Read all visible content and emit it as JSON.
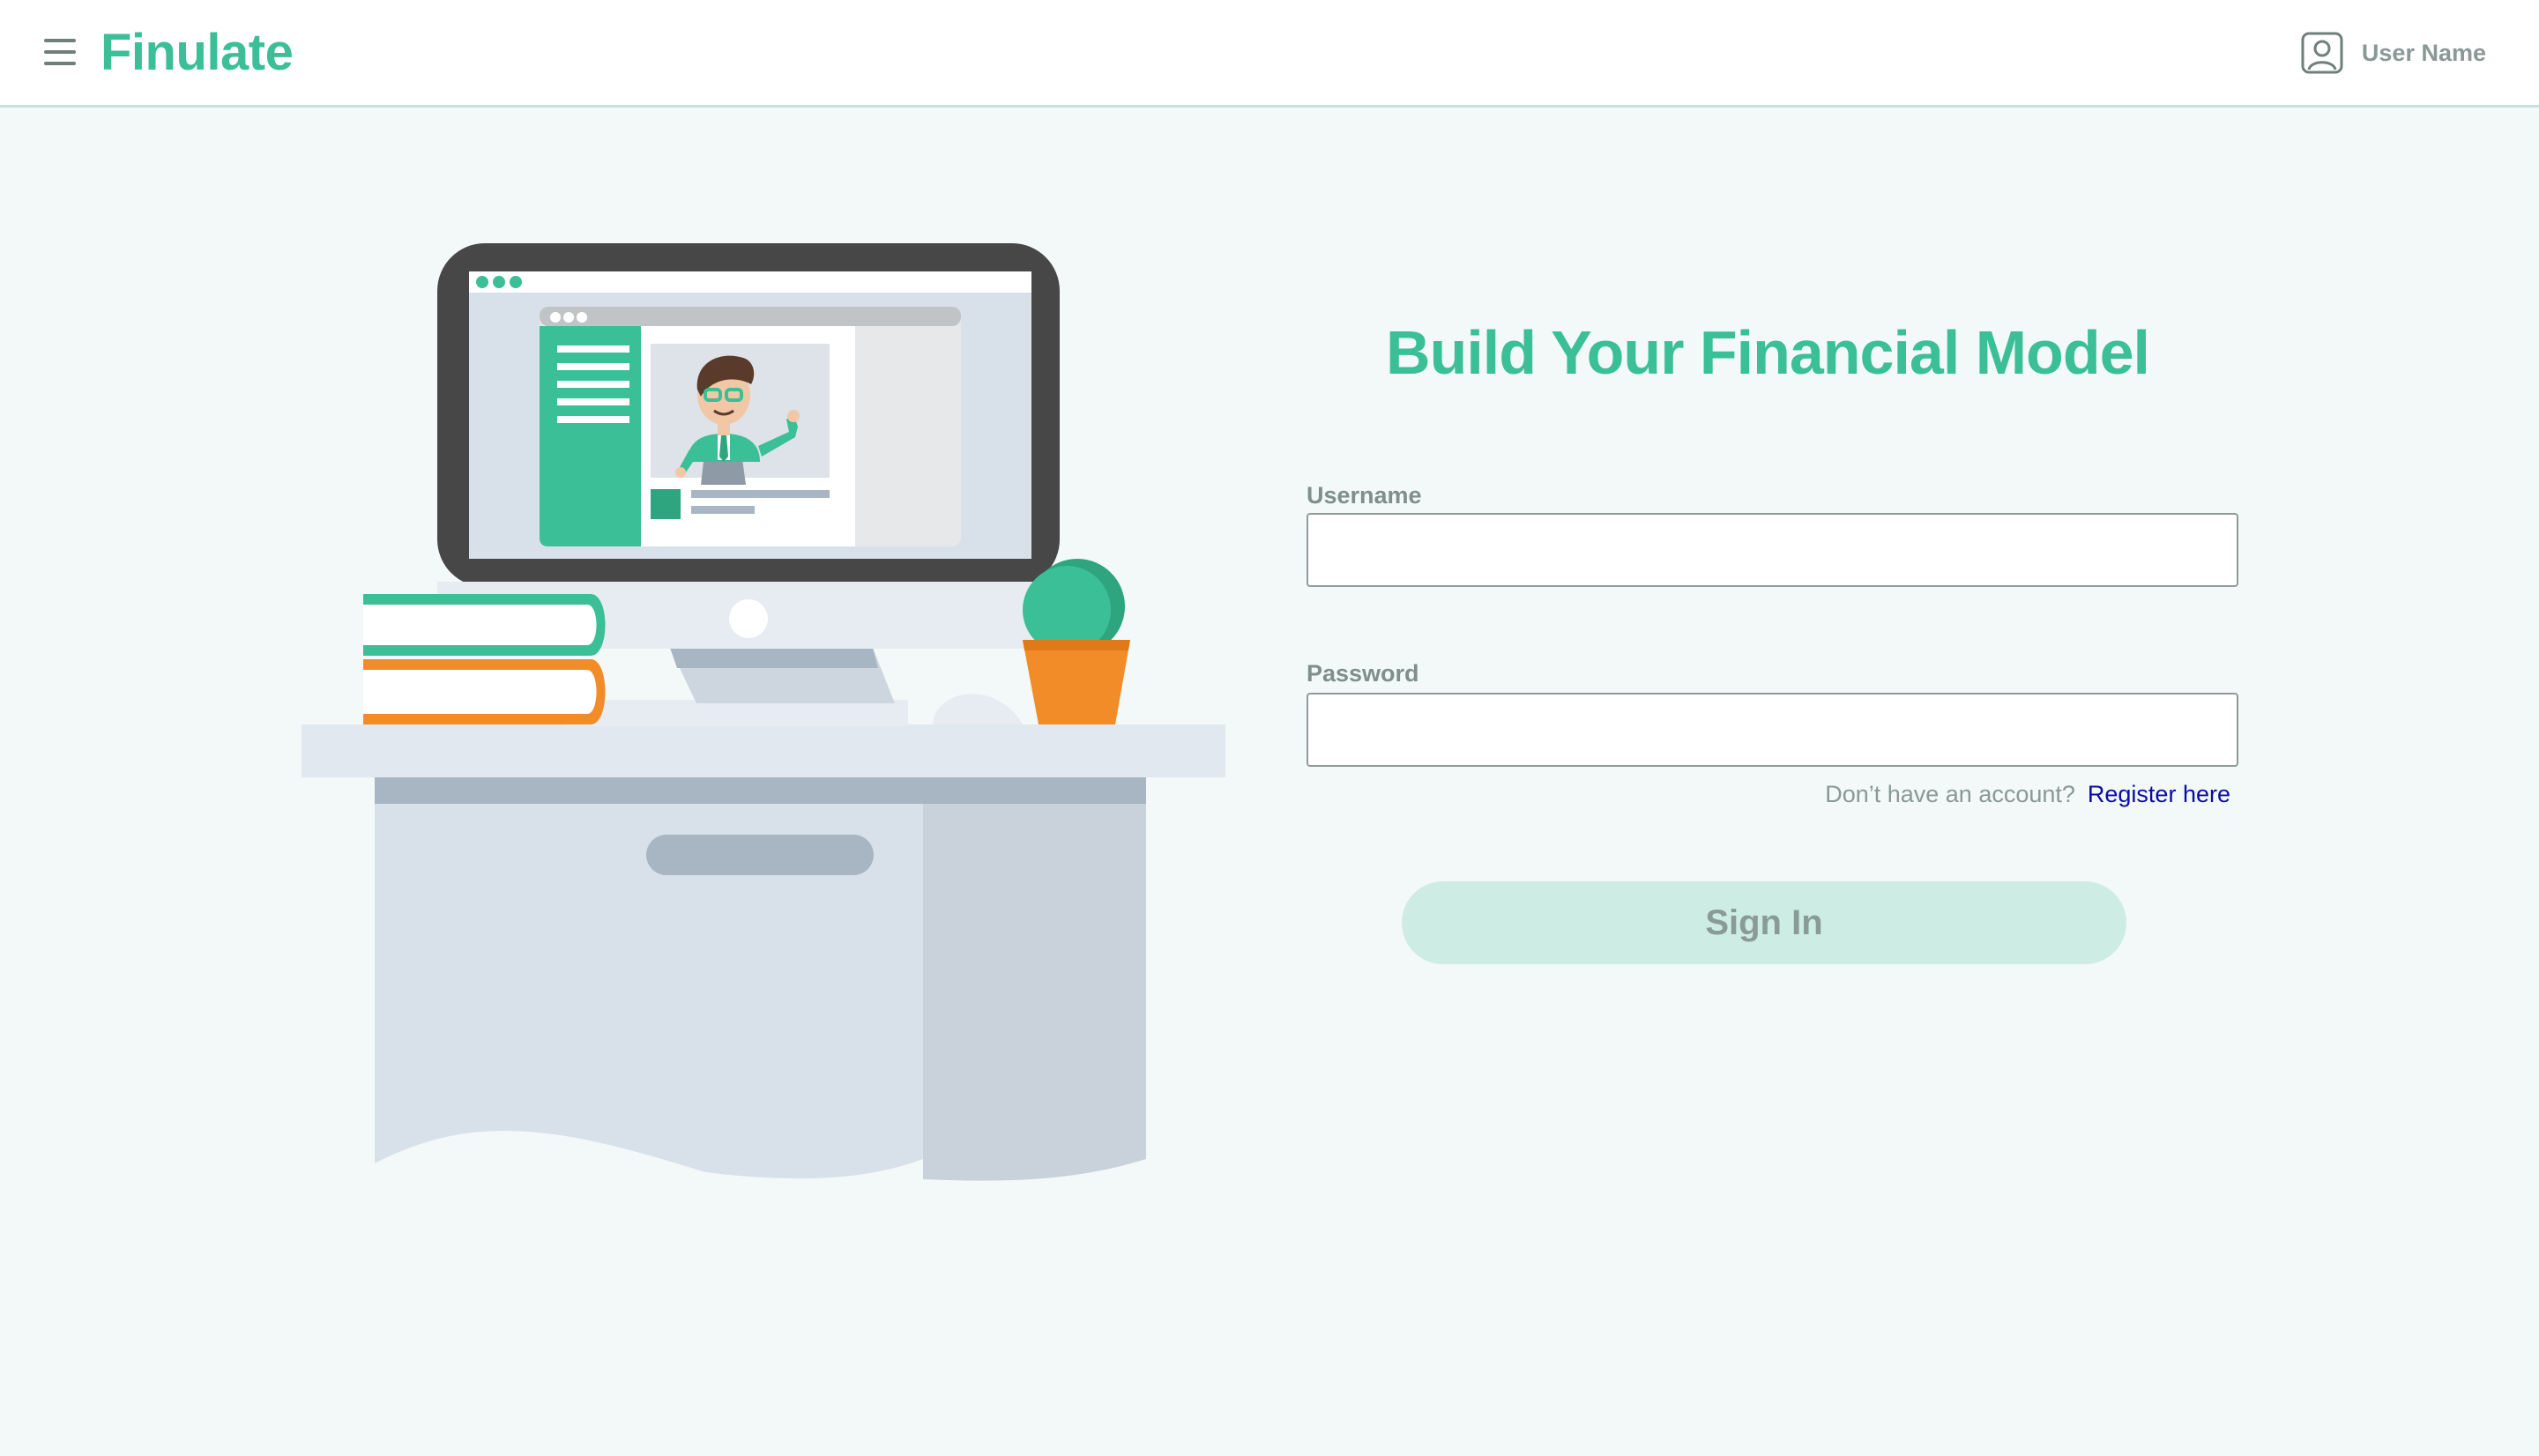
{
  "app": {
    "logo_text": "Finulate",
    "brand_color": "#3bbf96"
  },
  "header": {
    "menu_icon": "hamburger-menu-icon",
    "user_icon": "user-account-icon",
    "user_name": "User Name"
  },
  "login": {
    "title": "Build Your Financial Model",
    "username_label": "Username",
    "username_value": "",
    "password_label": "Password",
    "password_value": "",
    "register_prompt": "Don’t have an account?",
    "register_link": "Register here",
    "signin_label": "Sign In"
  },
  "colors": {
    "accent": "#3bbf96",
    "background": "#f3f9f8",
    "button_disabled": "#cdece3",
    "link": "#0b0ba8",
    "orange": "#f28c28"
  }
}
